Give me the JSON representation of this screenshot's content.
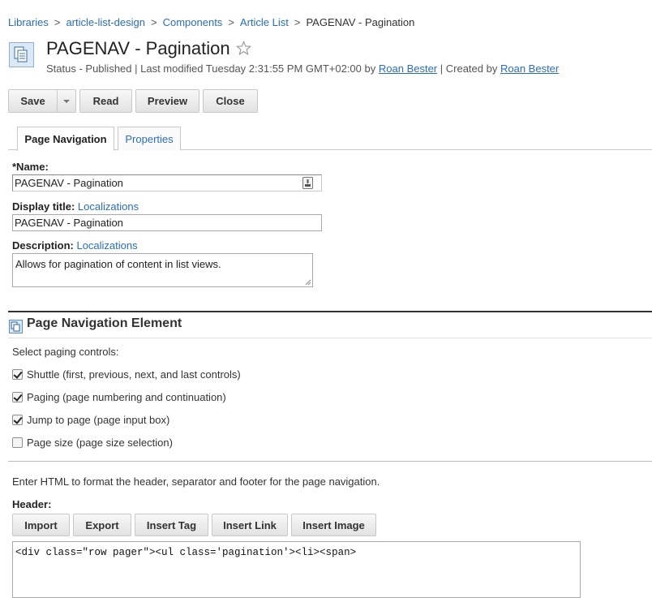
{
  "breadcrumb": {
    "items": [
      "Libraries",
      "article-list-design",
      "Components",
      "Article List"
    ],
    "separator": ">",
    "current": "PAGENAV - Pagination"
  },
  "header": {
    "icon": "component-document-icon",
    "title": "PAGENAV - Pagination",
    "favorite_icon": "star-outline-icon",
    "status_prefix": "Status - Published | Last modified Tuesday 2:31:55 PM GMT+02:00 by",
    "modified_by": "Roan Bester",
    "created_prefix": "| Created by",
    "created_by": "Roan Bester"
  },
  "toolbar": {
    "save": "Save",
    "read": "Read",
    "preview": "Preview",
    "close": "Close"
  },
  "tabs": [
    {
      "label": "Page Navigation",
      "active": true
    },
    {
      "label": "Properties",
      "active": false
    }
  ],
  "form": {
    "name_label": "*Name:",
    "name_value": "PAGENAV - Pagination",
    "display_title_label": "Display title:",
    "display_title_link": "Localizations",
    "display_title_value": "PAGENAV - Pagination",
    "description_label": "Description:",
    "description_link": "Localizations",
    "description_value": "Allows for pagination of content in list views."
  },
  "element": {
    "title": "Page Navigation Element",
    "paging_prompt": "Select paging controls:",
    "controls": [
      {
        "label": "Shuttle (first, previous, next, and last controls)",
        "checked": true
      },
      {
        "label": "Paging (page numbering and continuation)",
        "checked": true
      },
      {
        "label": "Jump to page (page input box)",
        "checked": true
      },
      {
        "label": "Page size (page size selection)",
        "checked": false
      }
    ],
    "html_prompt": "Enter HTML to format the header, separator and footer for the page navigation.",
    "header_label": "Header:",
    "buttons": [
      "Import",
      "Export",
      "Insert Tag",
      "Insert Link",
      "Insert Image"
    ],
    "header_html": "<div class=\"row pager\"><ul class='pagination'><li><span>"
  },
  "colors": {
    "link": "#2a6ebb",
    "button_bg": "#e8e8e8",
    "section_rule": "#333333"
  }
}
